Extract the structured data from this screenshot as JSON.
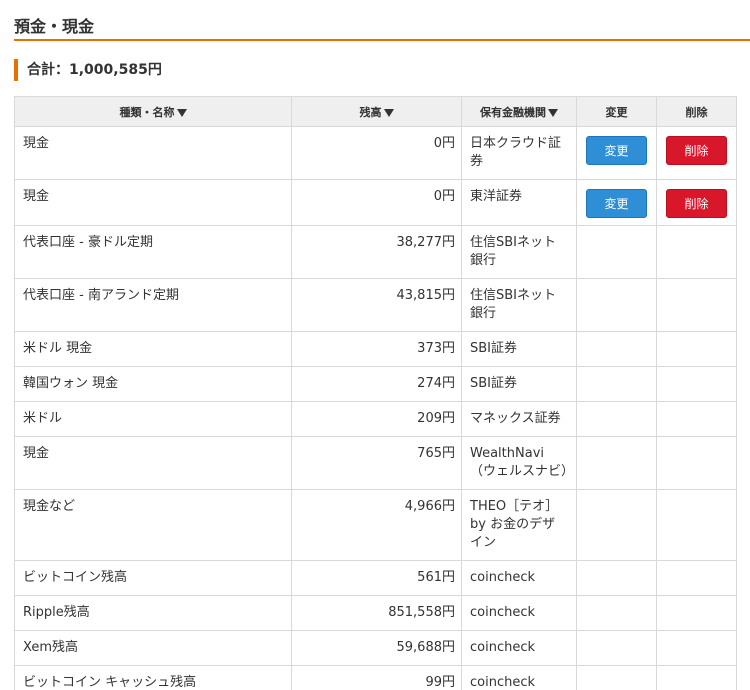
{
  "section": {
    "title": "預金・現金",
    "total_label": "合計：1,000,585円"
  },
  "table": {
    "headers": {
      "name": "種類・名称",
      "amount": "残高",
      "institution": "保有金融機関",
      "change": "変更",
      "delete": "削除"
    },
    "button_labels": {
      "change": "変更",
      "delete": "削除"
    },
    "rows": [
      {
        "name": "現金",
        "amount": "0円",
        "institution": "日本クラウド証券"
      },
      {
        "name": "現金",
        "amount": "0円",
        "institution": "東洋証券"
      },
      {
        "name": "代表口座 - 豪ドル定期",
        "amount": "38,277円",
        "institution": "住信SBIネット銀行"
      },
      {
        "name": "代表口座 - 南アランド定期",
        "amount": "43,815円",
        "institution": "住信SBIネット銀行"
      },
      {
        "name": "米ドル 現金",
        "amount": "373円",
        "institution": "SBI証券"
      },
      {
        "name": "韓国ウォン 現金",
        "amount": "274円",
        "institution": "SBI証券"
      },
      {
        "name": "米ドル",
        "amount": "209円",
        "institution": "マネックス証券"
      },
      {
        "name": "現金",
        "amount": "765円",
        "institution": "WealthNavi（ウェルスナビ）"
      },
      {
        "name": "現金など",
        "amount": "4,966円",
        "institution": "THEO［テオ］by お金のデザイン"
      },
      {
        "name": "ビットコイン残高",
        "amount": "561円",
        "institution": "coincheck"
      },
      {
        "name": "Ripple残高",
        "amount": "851,558円",
        "institution": "coincheck"
      },
      {
        "name": "Xem残高",
        "amount": "59,688円",
        "institution": "coincheck"
      },
      {
        "name": "ビットコイン キャッシュ残高",
        "amount": "99円",
        "institution": "coincheck"
      }
    ]
  },
  "colors": {
    "accent": "#e87000",
    "change_button": "#2f8fd6",
    "delete_button": "#d9172b",
    "header_bg": "#efefef"
  }
}
